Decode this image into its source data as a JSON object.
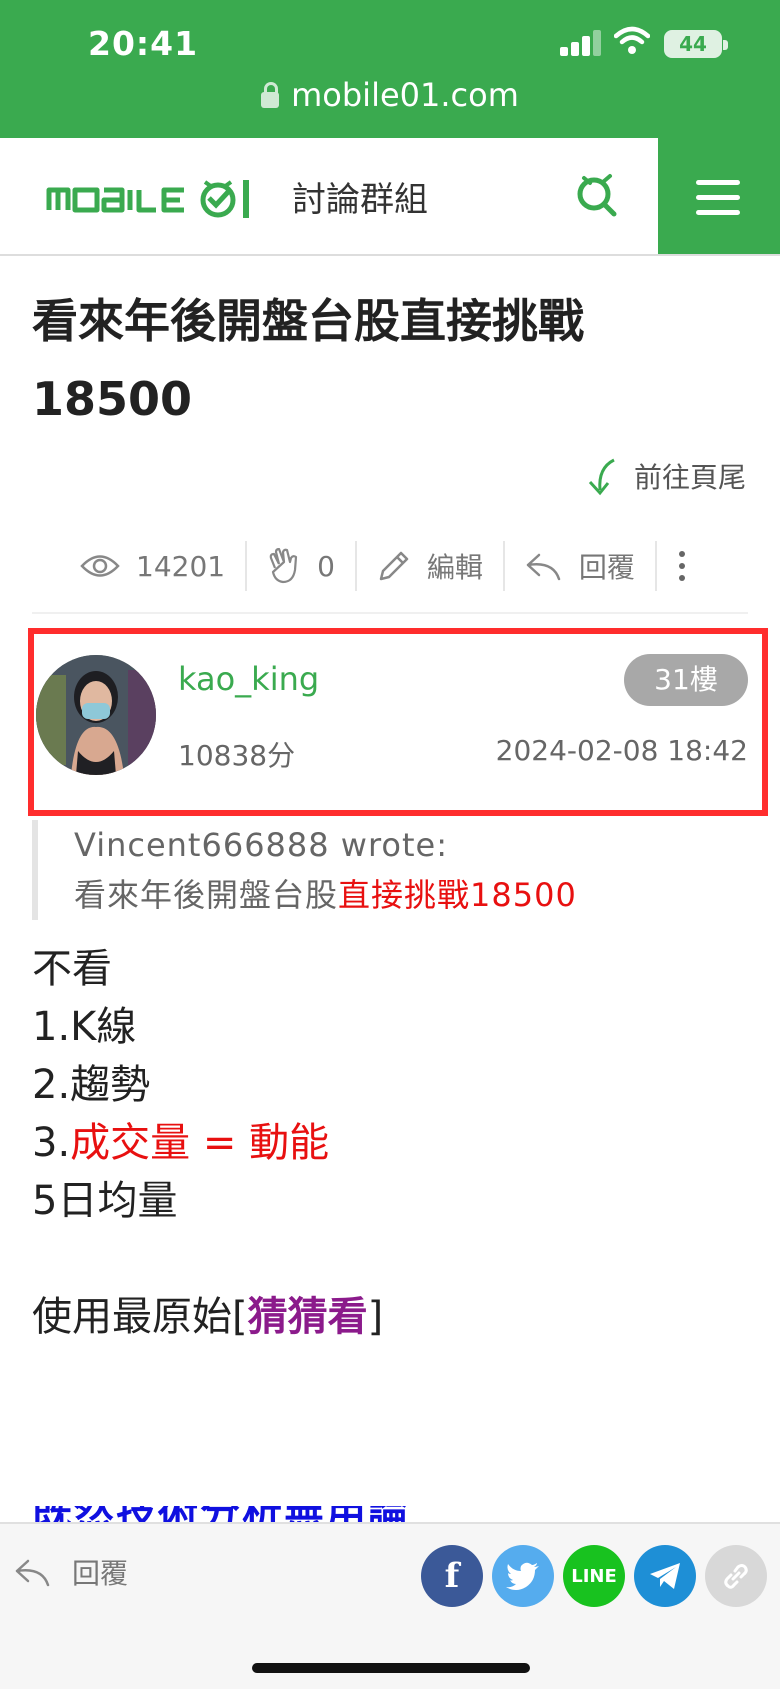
{
  "status_bar": {
    "time": "20:41",
    "url": "mobile01.com",
    "battery": "44"
  },
  "nav": {
    "logo": "MOBILE01",
    "section": "討論群組"
  },
  "thread": {
    "title": "看來年後開盤台股直接挑戰18500",
    "goto_footer": "前往頁尾"
  },
  "actions": {
    "views": "14201",
    "likes": "0",
    "edit": "編輯",
    "reply": "回覆"
  },
  "post": {
    "username": "kao_king",
    "floor": "31樓",
    "score": "10838分",
    "datetime": "2024-02-08 18:42",
    "quote_author": "Vincent666888 wrote:",
    "quote_text_a": "看來年後開盤台股",
    "quote_text_b": "直接挑戰18500",
    "lines": {
      "l1": "不看",
      "l2": "1.K線",
      "l3": "2.趨勢",
      "l4_num": "3.",
      "l4_text": "成交量 = 動能",
      "l5": "5日均量",
      "l6_a": "使用最原始[",
      "l6_b": "猜猜看",
      "l6_c": "]",
      "l7_cut": "既然技術分析無用論"
    }
  },
  "bottom_bar": {
    "reply": "回覆",
    "share": [
      "facebook",
      "twitter",
      "LINE",
      "telegram",
      "link"
    ]
  },
  "colors": {
    "brand_green": "#3aaa4f",
    "highlight_red": "#e81010",
    "box_red": "#ff2d2d",
    "purple": "#8b1a8b"
  }
}
